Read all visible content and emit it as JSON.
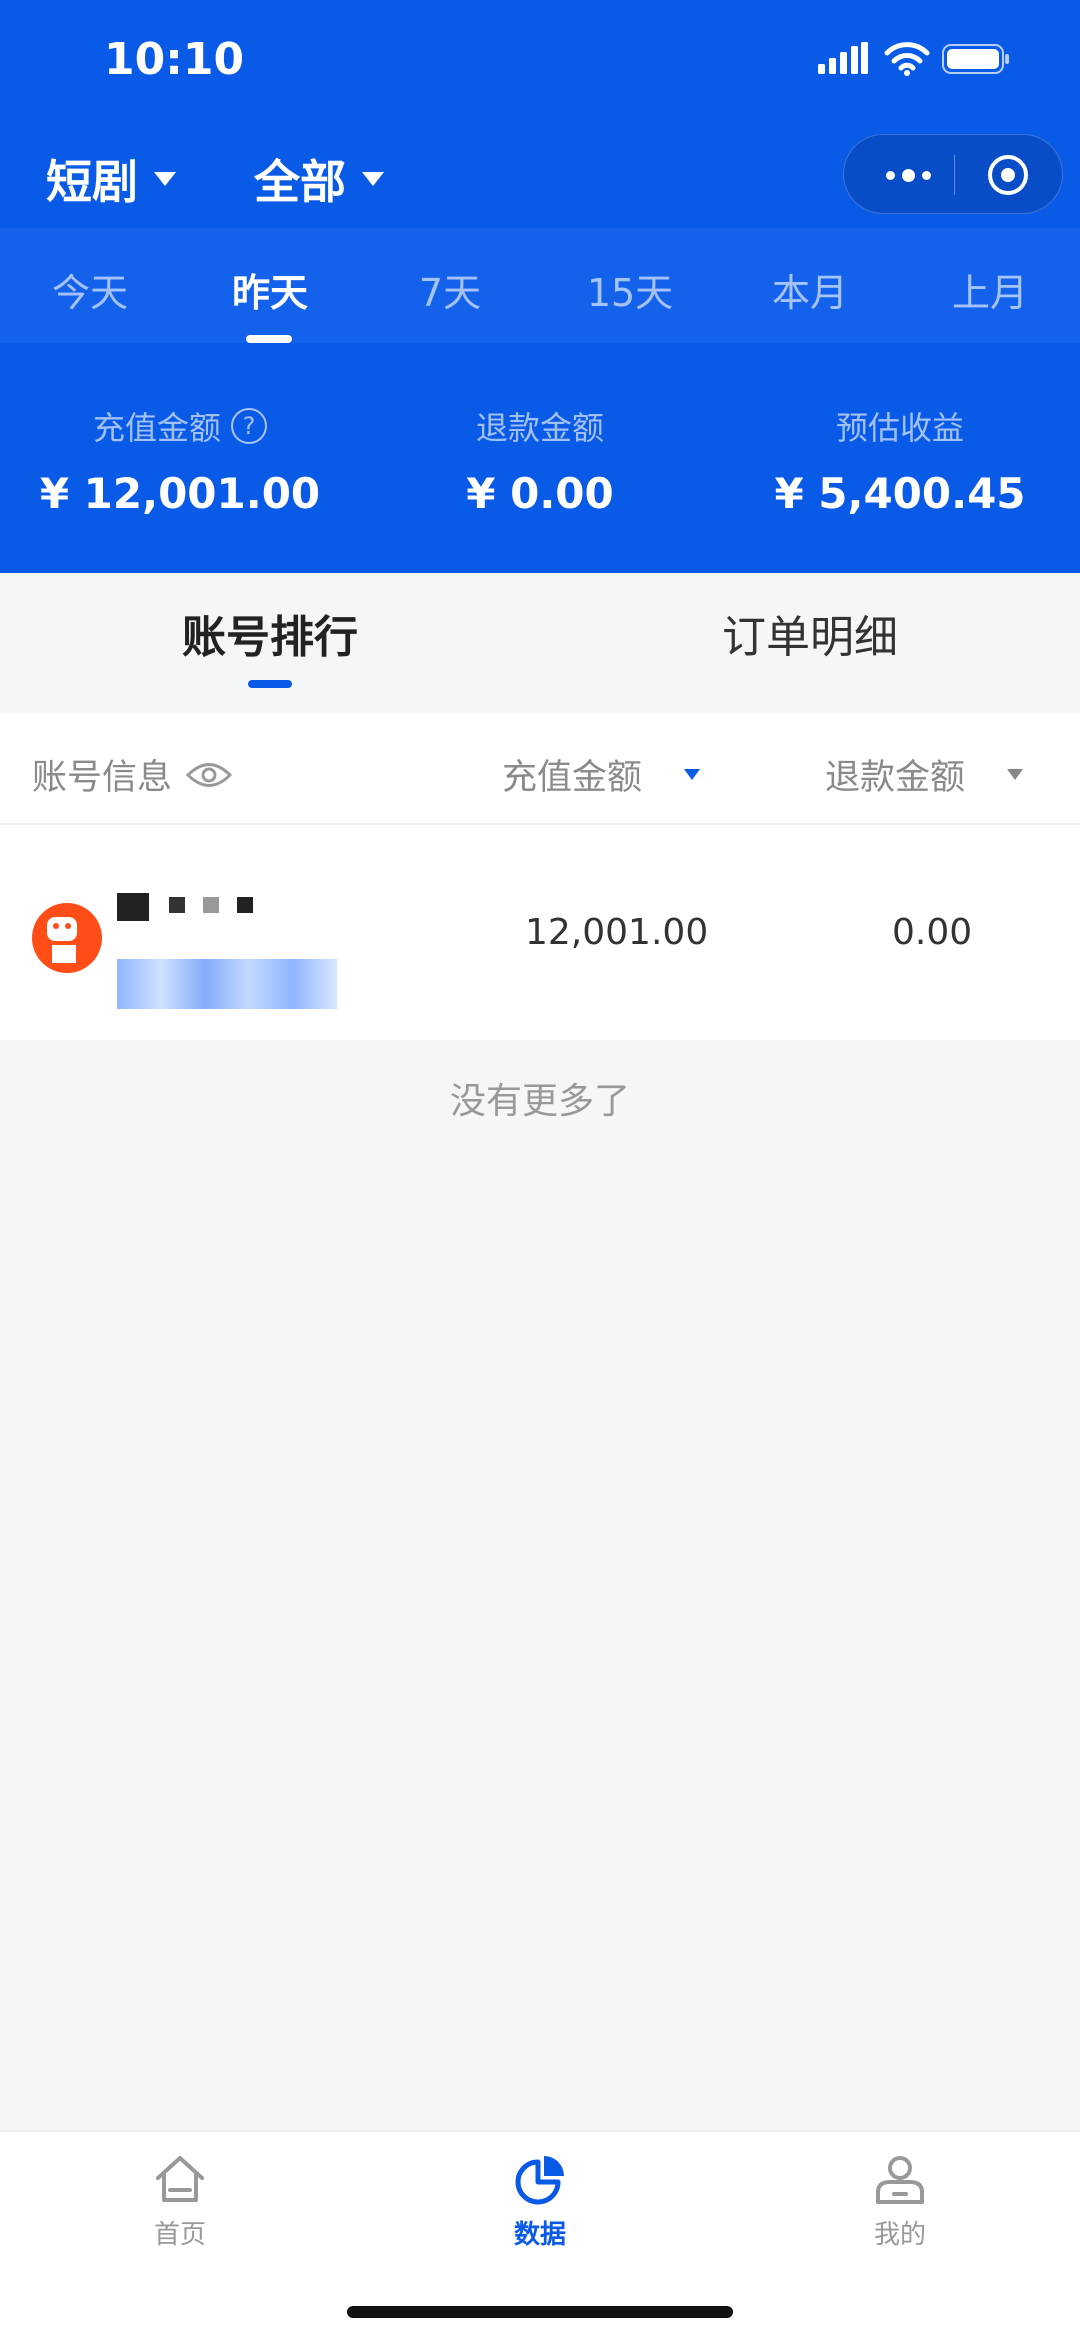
{
  "status_bar": {
    "time": "10:10"
  },
  "header": {
    "category_dropdown": "短剧",
    "scope_dropdown": "全部"
  },
  "date_tabs": [
    "今天",
    "昨天",
    "7天",
    "15天",
    "本月",
    "上月"
  ],
  "active_date_tab": "昨天",
  "stats": [
    {
      "label": "充值金额",
      "value": "¥ 12,001.00",
      "has_help": true
    },
    {
      "label": "退款金额",
      "value": "¥ 0.00"
    },
    {
      "label": "预估收益",
      "value": "¥ 5,400.45"
    }
  ],
  "sub_tabs": [
    "账号排行",
    "订单明细"
  ],
  "active_sub_tab": "账号排行",
  "table": {
    "columns": [
      "账号信息",
      "充值金额",
      "退款金额"
    ],
    "rows": [
      {
        "recharge": "12,001.00",
        "refund": "0.00"
      }
    ]
  },
  "list_footer": "没有更多了",
  "bottom_nav": [
    {
      "label": "首页",
      "icon": "home-icon"
    },
    {
      "label": "数据",
      "icon": "pie-chart-icon",
      "active": true
    },
    {
      "label": "我的",
      "icon": "user-icon"
    }
  ],
  "colors": {
    "brand": "#0a5ae8",
    "avatar": "#ff4d17"
  }
}
